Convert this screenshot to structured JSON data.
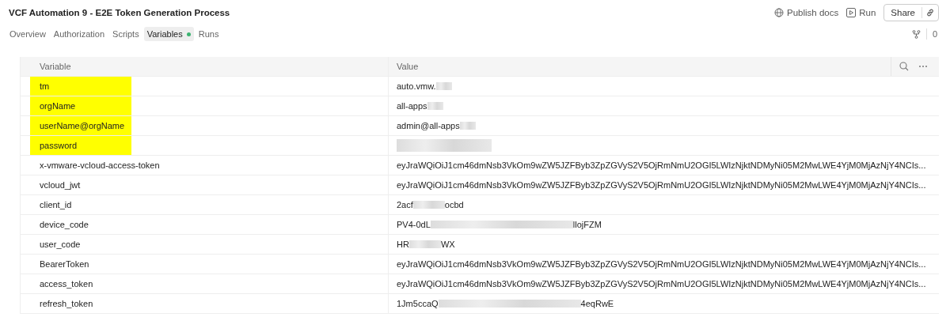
{
  "header": {
    "title": "VCF Automation 9 - E2E Token Generation Process",
    "actions": [
      {
        "kind": "publish",
        "label": "Publish docs"
      },
      {
        "kind": "run",
        "label": "Run"
      }
    ],
    "share": {
      "label": "Share"
    }
  },
  "tabs": [
    {
      "label": "Overview",
      "selected": false,
      "dot": false
    },
    {
      "label": "Authorization",
      "selected": false,
      "dot": false
    },
    {
      "label": "Scripts",
      "selected": false,
      "dot": false
    },
    {
      "label": "Variables",
      "selected": true,
      "dot": true
    },
    {
      "label": "Runs",
      "selected": false,
      "dot": false
    }
  ],
  "fork_count": "0",
  "table": {
    "columns": [
      "Variable",
      "Value"
    ],
    "rows": [
      {
        "variable": "tm",
        "highlighted": true,
        "value": "auto.vmw.",
        "redacted": true
      },
      {
        "variable": "orgName",
        "highlighted": true,
        "value": "all-apps",
        "redacted": true
      },
      {
        "variable": "userName@orgName",
        "highlighted": true,
        "value": "admin@all-apps",
        "redacted": true
      },
      {
        "variable": "password",
        "highlighted": true,
        "redacted": true
      },
      {
        "variable": "x-vmware-vcloud-access-token",
        "highlighted": false,
        "value": "eyJraWQiOiJ1cm46dmNsb3VkOm9wZW5JZFByb3ZpZGVyS2V5OjRmNmU2OGI5LWIzNjktNDMyNi05M2MwLWE4YjM0MjAzNjY4NCIs...",
        "redacted": false
      },
      {
        "variable": "vcloud_jwt",
        "highlighted": false,
        "value": "eyJraWQiOiJ1cm46dmNsb3VkOm9wZW5JZFByb3ZpZGVyS2V5OjRmNmU2OGI5LWIzNjktNDMyNi05M2MwLWE4YjM0MjAzNjY4NCIs...",
        "redacted": false
      },
      {
        "variable": "client_id",
        "highlighted": false,
        "value": "2acf",
        "redacted": true,
        "value_end": "ocbd"
      },
      {
        "variable": "device_code",
        "highlighted": false,
        "value": "PV4-0dL",
        "redacted": true,
        "value_end": "llojFZM"
      },
      {
        "variable": "user_code",
        "highlighted": false,
        "value": "HR",
        "redacted": true,
        "value_end": "WX"
      },
      {
        "variable": "BearerToken",
        "highlighted": false,
        "value": "eyJraWQiOiJ1cm46dmNsb3VkOm9wZW5JZFByb3ZpZGVyS2V5OjRmNmU2OGI5LWIzNjktNDMyNi05M2MwLWE4YjM0MjAzNjY4NCIs...",
        "redacted": false
      },
      {
        "variable": "access_token",
        "highlighted": false,
        "value": "eyJraWQiOiJ1cm46dmNsb3VkOm9wZW5JZFByb3ZpZGVyS2V5OjRmNmU2OGI5LWIzNjktNDMyNi05M2MwLWE4YjM0MjAzNjY4NCIs...",
        "redacted": false
      },
      {
        "variable": "refresh_token",
        "highlighted": false,
        "value": "1Jm5ccaQ",
        "redacted": true,
        "value_end": "4eqRwE"
      }
    ]
  }
}
